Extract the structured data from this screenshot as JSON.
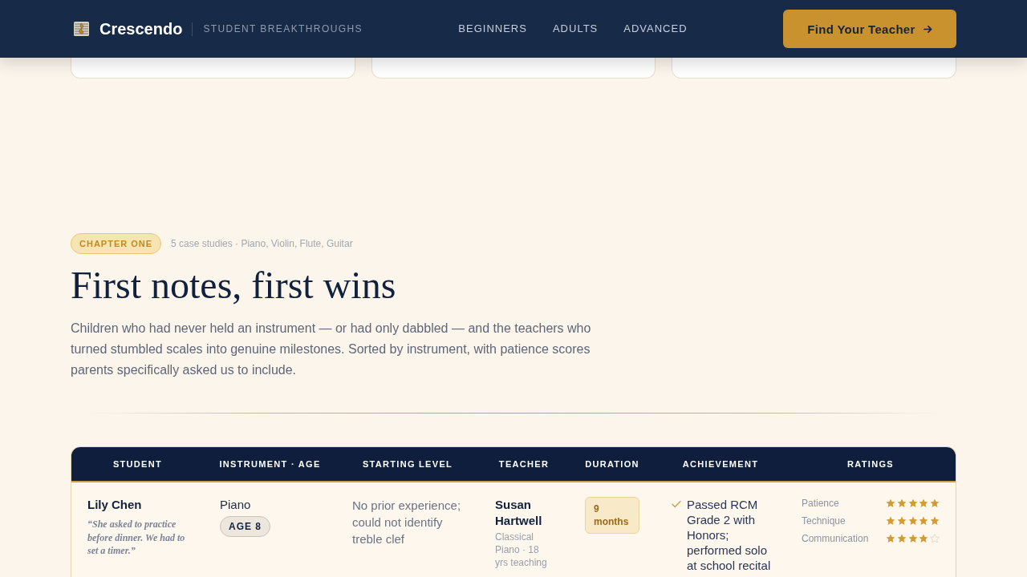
{
  "header": {
    "brand": "Crescendo",
    "tagline": "STUDENT BREAKTHROUGHS",
    "nav": [
      {
        "label": "BEGINNERS"
      },
      {
        "label": "ADULTS"
      },
      {
        "label": "ADVANCED"
      }
    ],
    "cta": {
      "label": "Find Your Teacher"
    }
  },
  "section": {
    "badge": "CHAPTER ONE",
    "meta": "5 case studies · Piano, Violin, Flute, Guitar",
    "title": "First notes, first wins",
    "intro": "Children who had never held an instrument — or had only dabbled — and the teachers who turned stumbled scales into genuine milestones. Sorted by instrument, with patience scores parents specifically asked us to include."
  },
  "table": {
    "columns": [
      "STUDENT",
      "INSTRUMENT · AGE",
      "STARTING LEVEL",
      "TEACHER",
      "DURATION",
      "ACHIEVEMENT",
      "RATINGS"
    ],
    "rows": [
      {
        "student": "Lily Chen",
        "quote": "“She asked to practice before dinner. We had to set a timer.”",
        "instrument": "Piano",
        "age": "AGE 8",
        "starting_level": "No prior experience; could not identify treble clef",
        "teacher": "Susan Hartwell",
        "teacher_details": "Classical Piano · 18 yrs teaching",
        "duration": "9 months",
        "achievement": "Passed RCM Grade 2 with Honors; performed solo at school recital",
        "ratings": [
          {
            "label": "Patience",
            "stars": 5
          },
          {
            "label": "Technique",
            "stars": 5
          },
          {
            "label": "Communication",
            "stars": 4
          }
        ]
      }
    ]
  }
}
